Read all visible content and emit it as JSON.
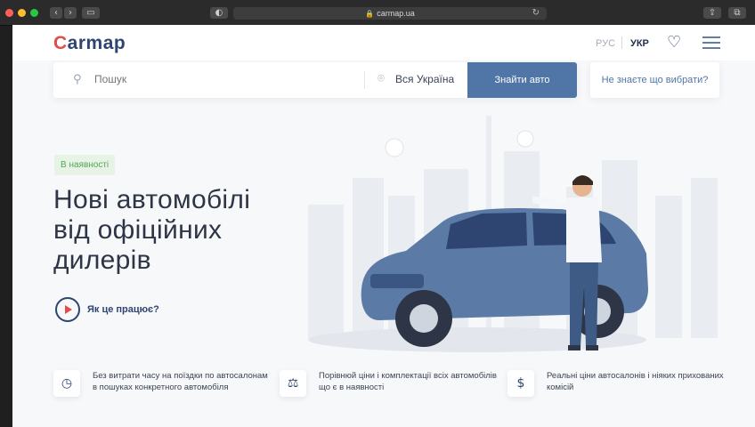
{
  "browser": {
    "url": "carmap.ua"
  },
  "header": {
    "logo_first": "C",
    "logo_rest": "armap",
    "lang_ru": "РУС",
    "lang_uk": "УКР"
  },
  "search": {
    "placeholder": "Пошук",
    "region": "Вся Україна",
    "find_label": "Знайти авто",
    "help_label": "Не знаєте що вибрати?"
  },
  "hero": {
    "badge": "В наявності",
    "title_line1": "Нові автомобілі",
    "title_line2": "від офіційних",
    "title_line3": "дилерів",
    "how_label": "Як це працює?"
  },
  "features": [
    {
      "icon": "clock-icon",
      "text": "Без витрати часу на поїздки по автосалонам в пошуках конкретного автомобіля"
    },
    {
      "icon": "scales-icon",
      "text": "Порівнюй ціни і комплектації всіх автомобілів що є в наявності"
    },
    {
      "icon": "dollar-icon",
      "text": "Реальні ціни автосалонів і ніяких прихованих комісій"
    }
  ],
  "colors": {
    "brand": "#2f4571",
    "accent_red": "#e14c4c",
    "button_blue": "#4f76a6",
    "badge_green": "#58a35a"
  }
}
